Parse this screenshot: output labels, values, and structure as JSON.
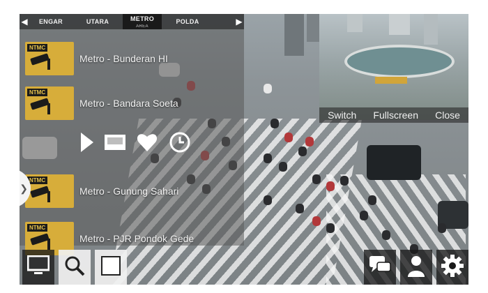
{
  "tabs": {
    "items": [
      {
        "label": "ENGAR"
      },
      {
        "label": "UTARA"
      },
      {
        "label": "METRO",
        "sub": "AREA"
      },
      {
        "label": "POLDA"
      }
    ],
    "prev_icon": "chevron-left-icon",
    "next_icon": "chevron-right-icon"
  },
  "cameras": [
    {
      "thumb_tag": "NTMC",
      "label": "Metro - Bunderan HI"
    },
    {
      "thumb_tag": "NTMC",
      "label": "Metro - Bandara Soeta"
    },
    {
      "thumb_tag": "NTMC",
      "label": "Metro - Gunung Sahari"
    },
    {
      "thumb_tag": "NTMC",
      "label": "Metro - PJR Pondok Gede"
    }
  ],
  "controls": {
    "play_icon": "play-icon",
    "screen_icon": "screen-icon",
    "favorite_icon": "heart-icon",
    "history_icon": "clock-icon"
  },
  "expand_icon": "chevron-right-icon",
  "pip": {
    "switch_label": "Switch",
    "fullscreen_label": "Fullscreen",
    "close_label": "Close"
  },
  "toolbar": {
    "left": [
      "monitor-icon",
      "search-icon",
      "square-icon"
    ],
    "right": [
      "chat-icon",
      "user-icon",
      "gear-icon"
    ]
  },
  "colors": {
    "thumb_bg": "#d7ad3a",
    "overlay": "#5a5a5a",
    "toolbar": "#191919"
  }
}
